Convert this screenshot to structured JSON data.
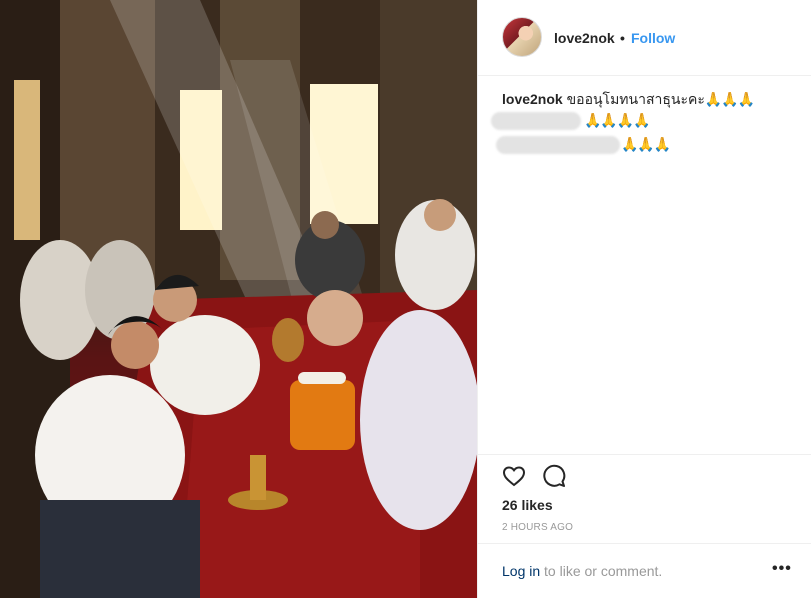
{
  "post": {
    "username": "love2nok",
    "separator": "•",
    "follow_label": "Follow",
    "caption": {
      "user": "love2nok",
      "text": "ขออนุโมทนาสาธุนะคะ",
      "emoji_line1": "🙏🙏🙏",
      "emoji_line2": "🙏🙏🙏🙏",
      "emoji_line3": "🙏🙏🙏"
    },
    "likes": "26 likes",
    "timestamp": "2 HOURS AGO",
    "login_link": "Log in",
    "login_text": " to like or comment.",
    "more_label": "•••"
  },
  "icons": {
    "like": "heart-icon",
    "comment": "comment-icon",
    "more": "more-options-icon"
  },
  "colors": {
    "follow": "#3897f0",
    "text": "#262626",
    "muted": "#999999",
    "link": "#003569"
  }
}
